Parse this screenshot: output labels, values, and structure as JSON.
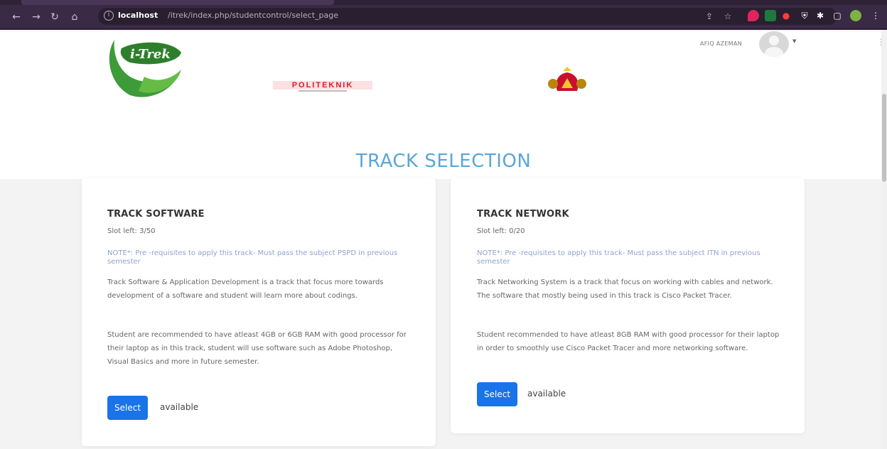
{
  "browser": {
    "url_host": "localhost",
    "url_path": "/itrek/index.php/studentcontrol/select_page"
  },
  "header": {
    "username": "AFIQ AZEMAN",
    "logo_text": "i-Trek",
    "politeknik_text": "POLITEKNIK"
  },
  "page": {
    "title": "TRACK SELECTION"
  },
  "tracks": [
    {
      "title": "TRACK SOFTWARE",
      "slot": "Slot left: 3/50",
      "note": "NOTE*: Pre -requisites to apply this track- Must pass the subject PSPD in previous semester",
      "desc1": "Track Software & Application Development is a track that focus more towards development of a software and student will learn more about codings.",
      "desc2": "Student are recommended to have atleast 4GB or 6GB RAM with good processor for their laptop as in this track, student will use software such as Adobe Photoshop, Visual Basics and more in future semester.",
      "button": "Select",
      "status": "available"
    },
    {
      "title": "TRACK NETWORK",
      "slot": "Slot left: 0/20",
      "note": "NOTE*: Pre -requisites to apply this track- Must pass the subject ITN in previous semester",
      "desc1": "Track Networking System is a track that focus on working with cables and network. The software that mostly being used in this track is Cisco Packet Tracer.",
      "desc2": "Student recommended to have atleast 8GB RAM with good processor for their laptop in order to smoothly use Cisco Packet Tracer and more networking software.",
      "button": "Select",
      "status": "available"
    }
  ],
  "colors": {
    "title": "#5aa6d6",
    "button": "#1a73e8",
    "note": "#8fa4cf"
  }
}
